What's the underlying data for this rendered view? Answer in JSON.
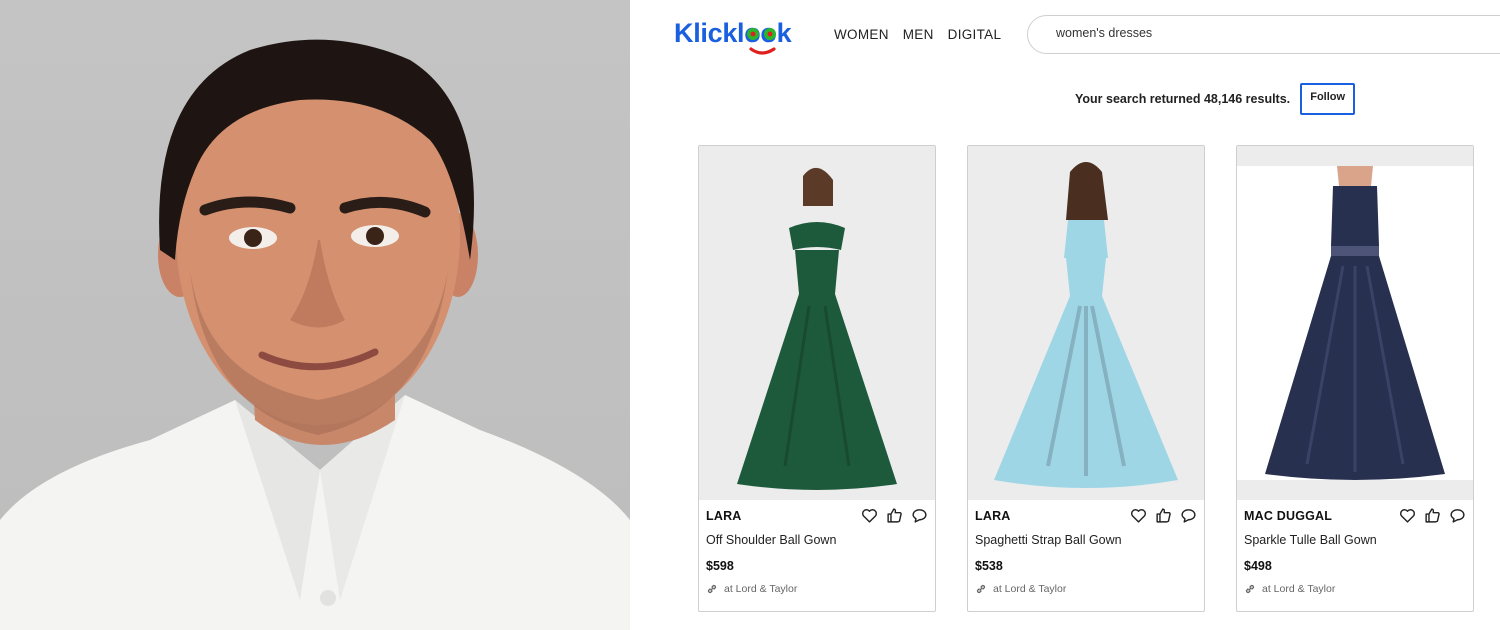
{
  "logo": {
    "text": "Klicklook"
  },
  "nav": [
    {
      "label": "WOMEN"
    },
    {
      "label": "MEN"
    },
    {
      "label": "DIGITAL"
    }
  ],
  "search": {
    "value": "women's dresses"
  },
  "results": {
    "text": "Your search returned 48,146 results.",
    "follow_label": "Follow"
  },
  "colors": {
    "brand_blue": "#1a5fe0",
    "logo_green": "#2bb52b",
    "logo_red": "#e02020"
  },
  "products": [
    {
      "brand": "LARA",
      "name": "Off Shoulder Ball Gown",
      "price": "$598",
      "store": "at Lord & Taylor",
      "dress_color": "#1d5a3c"
    },
    {
      "brand": "LARA",
      "name": "Spaghetti Strap Ball Gown",
      "price": "$538",
      "store": "at Lord & Taylor",
      "dress_color": "#9fd6e6"
    },
    {
      "brand": "MAC DUGGAL",
      "name": "Sparkle Tulle Ball Gown",
      "price": "$498",
      "store": "at Lord & Taylor",
      "dress_color": "#28304f"
    }
  ],
  "icons": [
    "heart-icon",
    "thumbs-up-icon",
    "comment-icon",
    "link-icon"
  ]
}
